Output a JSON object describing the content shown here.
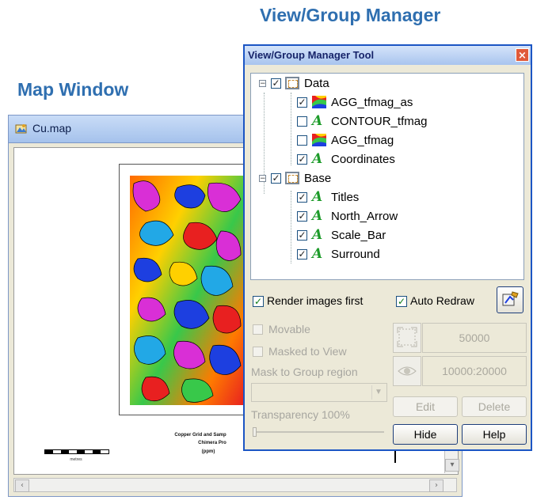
{
  "headings": {
    "map_window": "Map Window",
    "view_group_manager": "View/Group Manager"
  },
  "map_window": {
    "title": "Cu.map",
    "map_title_line1": "Copper Grid and Samp",
    "map_title_line2": "Chimera Pro",
    "map_title_line3": "(ppm)",
    "scale_label": "metres"
  },
  "tool": {
    "title": "View/Group Manager Tool",
    "close_label": "×",
    "tree": [
      {
        "label": "Data",
        "type": "group",
        "checked": true,
        "expanded": true
      },
      {
        "label": "AGG_tfmag_as",
        "type": "agg",
        "checked": true
      },
      {
        "label": "CONTOUR_tfmag",
        "type": "layer",
        "checked": false
      },
      {
        "label": "AGG_tfmag",
        "type": "agg",
        "checked": false
      },
      {
        "label": "Coordinates",
        "type": "layer",
        "checked": true
      },
      {
        "label": "Base",
        "type": "group",
        "checked": true,
        "expanded": true
      },
      {
        "label": "Titles",
        "type": "layer",
        "checked": true
      },
      {
        "label": "North_Arrow",
        "type": "layer",
        "checked": true
      },
      {
        "label": "Scale_Bar",
        "type": "layer",
        "checked": true
      },
      {
        "label": "Surround",
        "type": "layer",
        "checked": true
      }
    ],
    "render_images_first": "Render images first",
    "auto_redraw": "Auto Redraw",
    "movable": "Movable",
    "masked_to_view": "Masked to View",
    "mask_to_group_region": "Mask to Group region",
    "scale_value": "50000",
    "range_value": "10000:20000",
    "transparency": "Transparency 100%",
    "transparency_level": 0,
    "edit_label": "Edit",
    "delete_label": "Delete",
    "hide_label": "Hide",
    "help_label": "Help"
  },
  "colors": {
    "heading": "#2f6fb0",
    "titlebar_active": "#1b55c4",
    "close_button": "#e05a3a"
  }
}
